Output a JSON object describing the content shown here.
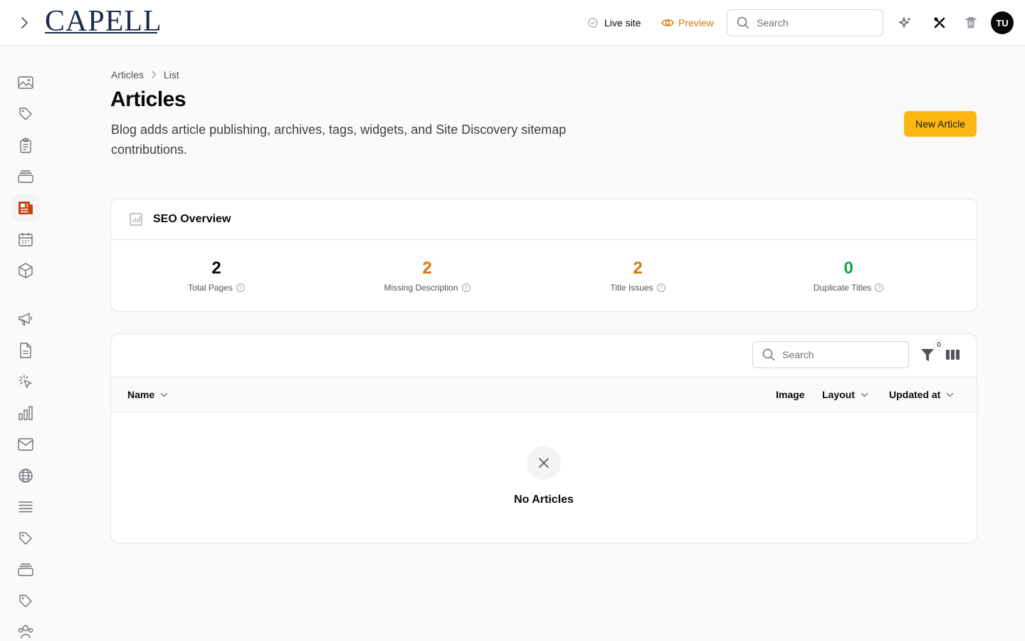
{
  "header": {
    "logo": "CAPELL",
    "live_site_label": "Live site",
    "preview_label": "Preview",
    "search_placeholder": "Search",
    "avatar_initials": "TU"
  },
  "breadcrumb": {
    "items": [
      "Articles",
      "List"
    ]
  },
  "page": {
    "title": "Articles",
    "description": "Blog adds article publishing, archives, tags, widgets, and Site Discovery sitemap contributions.",
    "new_button_label": "New Article"
  },
  "seo": {
    "title": "SEO Overview",
    "stats": [
      {
        "value": "2",
        "label": "Total Pages",
        "color": "#09090b"
      },
      {
        "value": "2",
        "label": "Missing Description",
        "color": "#d97706"
      },
      {
        "value": "2",
        "label": "Title Issues",
        "color": "#d97706"
      },
      {
        "value": "0",
        "label": "Duplicate Titles",
        "color": "#16a34a"
      }
    ]
  },
  "table": {
    "search_placeholder": "Search",
    "filter_count": "0",
    "columns": {
      "name": "Name",
      "image": "Image",
      "layout": "Layout",
      "updated_at": "Updated at"
    },
    "empty_title": "No Articles"
  },
  "colors": {
    "accent": "#fbb812",
    "warning": "#d97706",
    "success": "#16a34a",
    "active_icon": "#c2410c"
  }
}
